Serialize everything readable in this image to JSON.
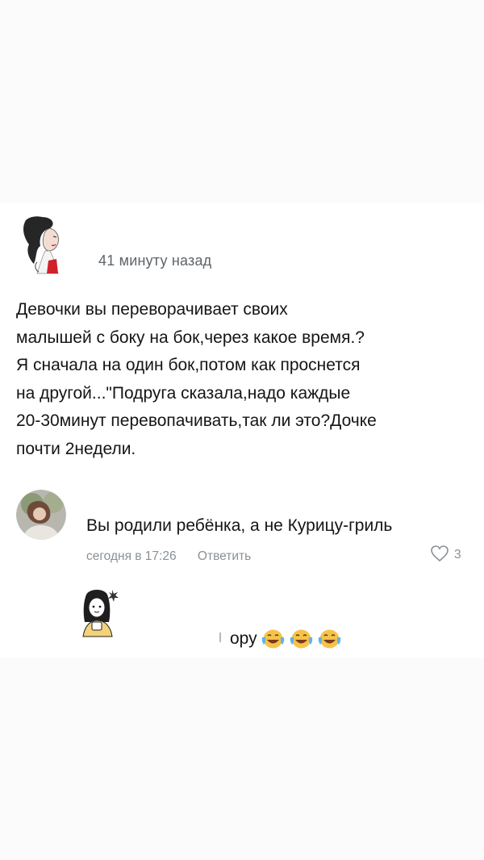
{
  "post": {
    "time": "41 минуту назад",
    "text": "Девочки вы переворачивает своих\nмалышей с боку на бок,через какое время.?\nЯ сначала на один бок,потом как проснется\nна другой...\"Подруга сказала,надо каждые\n20-30минут перевопачивать,так ли это?Дочке\nпочти 2недели."
  },
  "comment1": {
    "text": "Вы родили ребёнка, а не Курицу-гриль",
    "time": "сегодня в 17:26",
    "reply_label": "Ответить",
    "likes": "3"
  },
  "comment2": {
    "text": "ору",
    "emoji": [
      "laughing-tears-emoji",
      "laughing-tears-emoji",
      "laughing-tears-emoji"
    ]
  },
  "colors": {
    "meta_gray": "#8a9095",
    "emoji_yellow": "#f6c34a"
  }
}
